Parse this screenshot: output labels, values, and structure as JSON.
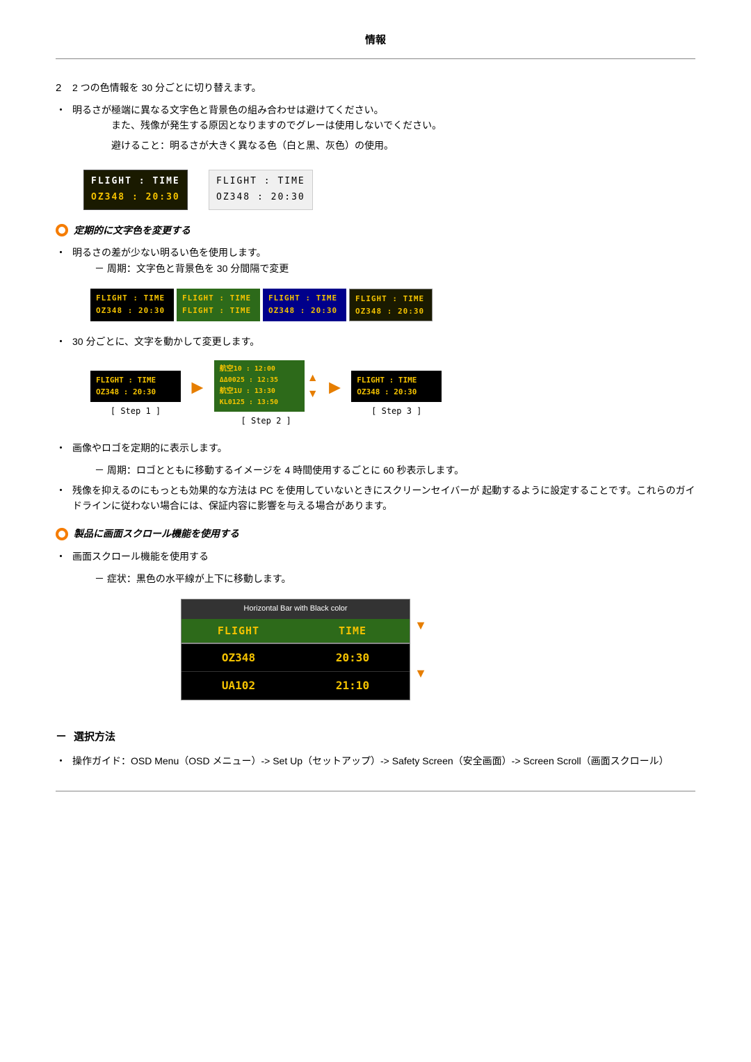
{
  "page": {
    "title": "情報",
    "section1": {
      "text1": "2 つの色情報を 30 分ごとに切り替えます。",
      "bullet1": {
        "dot": "・",
        "text": "明るさが極端に異なる文字色と背景色の組み合わせは避けてください。",
        "sub1": "また、残像が発生する原因となりますのでグレーは使用しないでください。",
        "sub2": "避けること：明るさが大きく異なる色（白と黒、灰色）の使用。"
      }
    },
    "display_dark": {
      "header": "FLIGHT  :  TIME",
      "data": "OZ348   :  20:30"
    },
    "display_light": {
      "header": "FLIGHT  :  TIME",
      "data": "OZ348  :  20:30"
    },
    "section2": {
      "header": "定期的に文字色を変更する",
      "bullet1": {
        "dot": "・",
        "text": "明るさの差が少ない明るい色を使用します。",
        "sub1": "－ 周期：文字色と背景色を 30 分間隔で変更"
      },
      "boxes": [
        {
          "bg": "#000",
          "headerColor": "#f5c300",
          "dataColor": "#f5c300",
          "header": "FLIGHT  :  TIME",
          "data": "OZ348  :  20:30"
        },
        {
          "bg": "#2d6a1a",
          "headerColor": "#f5c300",
          "dataColor": "#f5c300",
          "header": "FLIGHT  :  TIME",
          "data": "FLIGHT  :  TIME"
        },
        {
          "bg": "#00008b",
          "headerColor": "#f5c300",
          "dataColor": "#f5c300",
          "header": "FLIGHT  :  TIME",
          "data": "OZ348  :  20:30"
        },
        {
          "bg": "#1a1a00",
          "headerColor": "#f5c300",
          "dataColor": "#f5c300",
          "header": "FLIGHT  :  TIME",
          "data": "OZ348  :  20:30"
        }
      ]
    },
    "section3": {
      "bullet": {
        "dot": "・",
        "text": "30 分ごとに、文字を動かして変更します。"
      },
      "steps": {
        "step1": {
          "label": "[ Step 1 ]",
          "header": "FLIGHT  :  TIME",
          "data": "OZ348  :  20:30"
        },
        "step2_row1": "航空10 : 12:00",
        "step2_row2": "ΔΔ0025 : 12:35",
        "step2_row3": "航空1U : 13:30",
        "step2_row4": "KL0125 : 13:50",
        "step2_label": "[ Step 2 ]",
        "step3": {
          "label": "[ Step 3 ]",
          "header": "FLIGHT  :  TIME",
          "data": "OZ348  :  20:30"
        }
      }
    },
    "section4": {
      "bullet1": "・ 画像やロゴを定期的に表示します。",
      "sub1": "－ 周期：ロゴとともに移動するイメージを 4 時間使用するごとに 60 秒表示します。",
      "bullet2_text": "残像を抑えるのにもっとも効果的な方法は PC を使用していないときにスクリーンセイバーが 起動するように設定することです。これらのガイドラインに従わない場合には、保証内容に影響を与える場合があります。"
    },
    "section5": {
      "header": "製品に画面スクロール機能を使用する",
      "bullet1": "・ 画面スクロール機能を使用する",
      "sub1": "－ 症状：黒色の水平線が上下に移動します。",
      "scroll_diagram": {
        "title": "Horizontal Bar with Black color",
        "header_left": "FLIGHT",
        "header_right": "TIME",
        "row1_left": "OZ348",
        "row1_right": "20:30",
        "row2_left": "UA102",
        "row2_right": "21:10"
      }
    },
    "section6": {
      "selection_title": "選択方法",
      "bullet": "・",
      "guide_text": "操作ガイド：OSD Menu（OSD メニュー）-> Set Up（セットアップ）-> Safety Screen（安全画面）-> Screen Scroll（画面スクロール）"
    }
  }
}
